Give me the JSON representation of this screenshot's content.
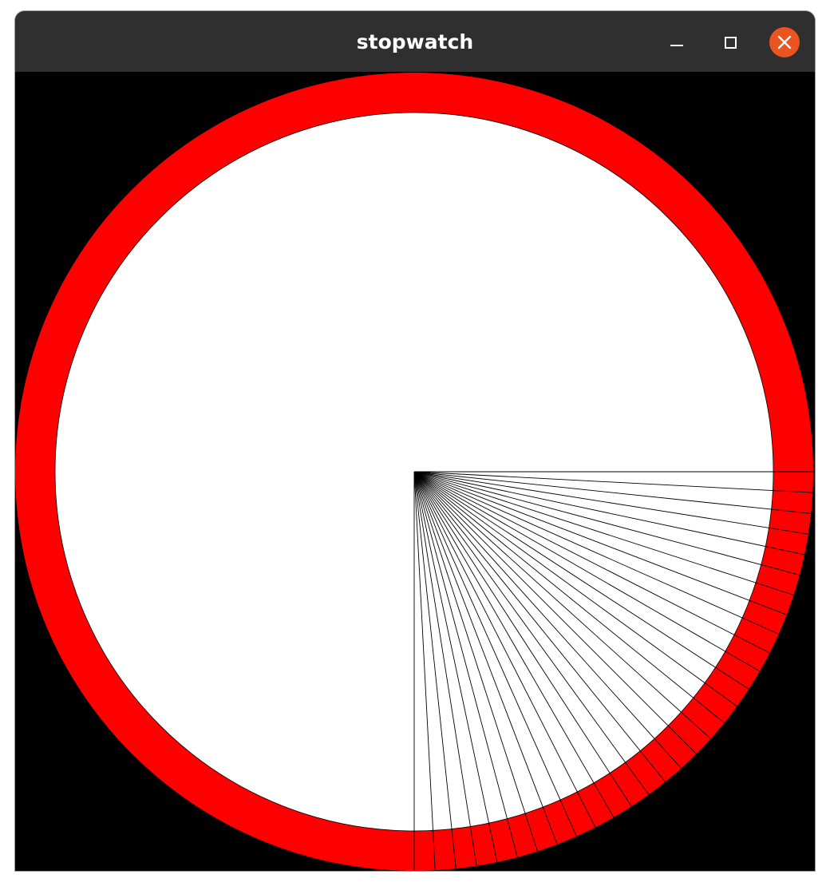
{
  "window": {
    "title": "stopwatch"
  },
  "controls": {
    "minimize_icon": "minimize-icon",
    "maximize_icon": "maximize-icon",
    "close_icon": "close-icon",
    "close_color": "#e95420"
  },
  "stopwatch": {
    "ring_color": "#ff0000",
    "face_color": "#ffffff",
    "background_color": "#000000",
    "line_color": "#000000",
    "elapsed_ticks": 30,
    "ticks_per_revolution": 120
  }
}
